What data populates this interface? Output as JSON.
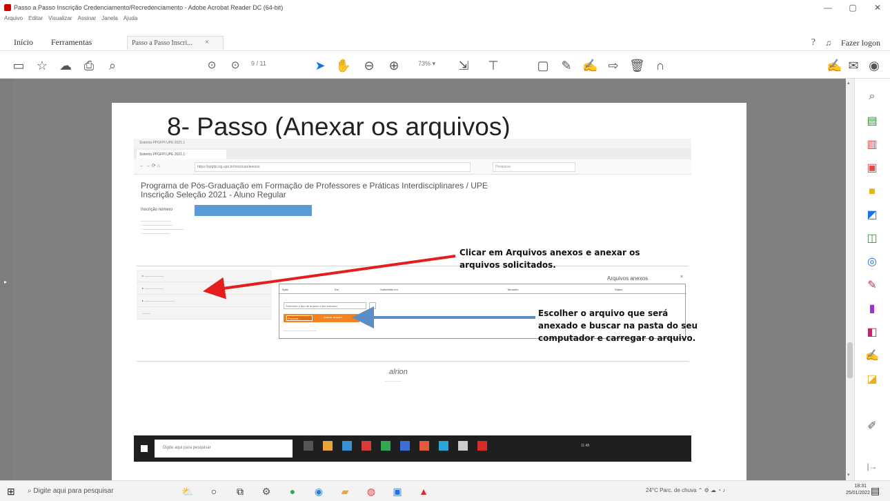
{
  "window": {
    "title": "Passo a Passo Inscrição Credenciamento/Recredenciamento - Adobe Acrobat Reader DC (64-bit)",
    "menu": [
      "Arquivo",
      "Editar",
      "Visualizar",
      "Assinar",
      "Janela",
      "Ajuda"
    ]
  },
  "tabs": {
    "home": "Início",
    "tools": "Ferramentas",
    "document": "Passo a Passo Inscri...",
    "login": "Fazer logon"
  },
  "toolbar": {
    "page_current": "9",
    "page_total": "/ 11",
    "zoom": "73%"
  },
  "slide": {
    "title": "8- Passo (Anexar os arquivos)",
    "browser_tab": "Sistema PPGFPI UPE 2021.1",
    "address": "https://ppgfpi.sig.upe.br/inscricao/anexos",
    "search_placeholder": "Pesquisar",
    "program_heading": "Programa de Pós-Graduação em Formação de Professores e Práticas Interdisciplinares / UPE",
    "subheading": "Inscrição Seleção 2021 - Aluno Regular",
    "inscricao_label": "Inscrição número",
    "arquivos_title": "Arquivos anexos",
    "arquivos_close": "×",
    "table_cols": [
      "Ação",
      "Ext.",
      "Submetido em",
      "Tamanho",
      "Status"
    ],
    "select_placeholder": "Selecione o tipo de arquivo a ser anexado",
    "browse_btn": "Procurar...",
    "upload_text": "Anexar arquivo",
    "logo": "alrion",
    "annotation1": "Clicar em Arquivos anexos e anexar os arquivos solicitados.",
    "annotation2": "Escolher o arquivo que será anexado e buscar na pasta do seu computador e carregar o arquivo.",
    "inner_search": "Digite aqui para pesquisar",
    "inner_clock": "11:48"
  },
  "taskbar": {
    "search": "Digite aqui para pesquisar",
    "weather": "24°C  Parc. de chuva",
    "clock_time": "18:31",
    "clock_date": "25/01/2022"
  },
  "colors": {
    "workspace_gray": "#808080",
    "acrobat_blue": "#1473e6",
    "arrow_red": "#e41e1e",
    "arrow_blue": "#5b8ec4",
    "orange": "#f58220"
  }
}
